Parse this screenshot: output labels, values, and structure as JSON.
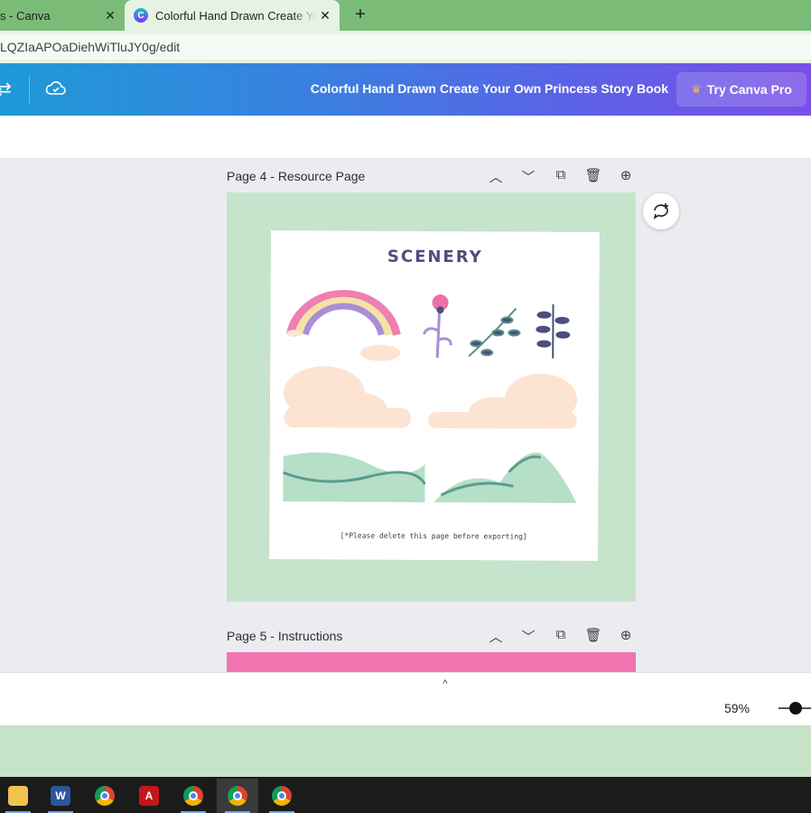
{
  "browser": {
    "tabs": [
      {
        "title": "s - Canva",
        "active": false
      },
      {
        "title": "Colorful Hand Drawn Create Your Own Princess Story Book",
        "active": true
      }
    ],
    "new_tab_label": "+",
    "url": "LQZIaAPOaDiehWiTluJY0g/edit"
  },
  "header": {
    "doc_title": "Colorful Hand Drawn Create Your Own Princess Story Book",
    "try_pro_label": "Try Canva Pro",
    "colors": {
      "gradient_start": "#1e9ad7",
      "gradient_end": "#7a4fe8"
    }
  },
  "pages": [
    {
      "title": "Page 4 - Resource Page",
      "canvas": {
        "heading": "SCENERY",
        "note": "[*Please delete this page before exporting]",
        "background": "#c6e3cc"
      }
    },
    {
      "title": "Page 5 - Instructions",
      "background": "#ef74b0"
    }
  ],
  "page_controls": [
    "chevron-up-icon",
    "chevron-down-icon",
    "duplicate-icon",
    "trash-icon",
    "add-page-icon"
  ],
  "footer": {
    "expand_label": "^",
    "zoom": "59%"
  },
  "taskbar": {
    "apps": [
      "file-explorer",
      "word",
      "chrome",
      "acrobat",
      "chrome-profile",
      "chrome-profile",
      "chrome-profile"
    ]
  }
}
